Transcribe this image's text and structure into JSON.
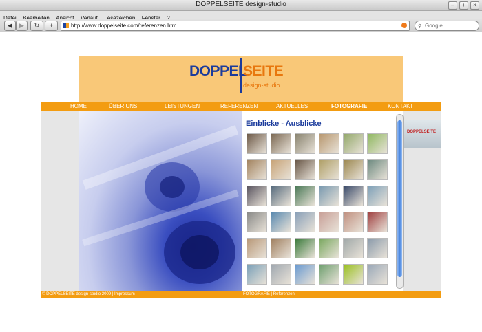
{
  "window": {
    "title": "DOPPELSEITE design-studio",
    "controls": [
      "–",
      "+",
      "×"
    ]
  },
  "menu": [
    "Datei",
    "Bearbeiten",
    "Ansicht",
    "Verlauf",
    "Lesezeichen",
    "Fenster",
    "?"
  ],
  "toolbar": {
    "back": "◀",
    "forward": "▶",
    "reload": "↻",
    "add": "+",
    "url": "http://www.doppelseite.com/referenzen.htm",
    "search_placeholder": "Google"
  },
  "site": {
    "logo_left": "DOPPEL",
    "logo_right": "SEITE",
    "logo_sub": "design-studio",
    "nav": [
      "HOME",
      "ÜBER UNS",
      "LEISTUNGEN",
      "REFERENZEN",
      "AKTUELLES",
      "FOTOGRAFIE",
      "KONTAKT"
    ],
    "active_nav": "FOTOGRAFIE",
    "gallery_title": "Einblicke - Ausblicke",
    "peek_label": "DOPPELSEITE",
    "footer_left": "© DOPPELSEITE design-studio 2009 | Impressum",
    "footer_mid": "FOTOGRAFIE | Referenzen",
    "thumb_colors": [
      [
        "#6e5a48",
        "#7d6a54",
        "#8a8470",
        "#b89870",
        "#93a86a",
        "#8fb860"
      ],
      [
        "#a38460",
        "#c8a478",
        "#6a5848",
        "#b0a068",
        "#9c8850",
        "#6d8a80"
      ],
      [
        "#5a5560",
        "#586c7e",
        "#4c7a58",
        "#7a9ab0",
        "#3a4a6a",
        "#7ea0b8"
      ],
      [
        "#8a8a88",
        "#5a8ab0",
        "#8aa0b8",
        "#c8a098",
        "#c09080",
        "#a04040"
      ],
      [
        "#b89878",
        "#a08060",
        "#3a7a3a",
        "#7aa860",
        "#a0a8a8",
        "#8a9aaa"
      ],
      [
        "#7aa0b8",
        "#a0a8b0",
        "#6a9ad0",
        "#70a070",
        "#9ac020",
        "#9aa8b8"
      ]
    ]
  }
}
